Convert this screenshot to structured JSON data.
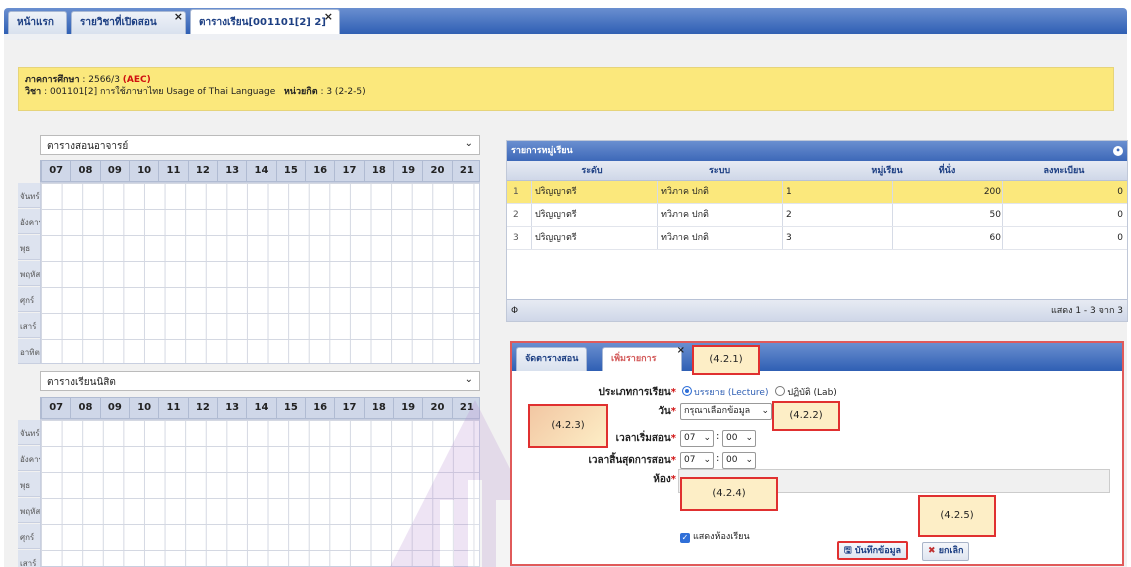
{
  "tabs": [
    {
      "label": "หน้าแรก"
    },
    {
      "label": "รายวิชาที่เปิดสอน",
      "close": "×"
    },
    {
      "label": "ตารางเรียน[001101[2] 2]",
      "close": "×"
    }
  ],
  "info": {
    "semester_label": "ภาคการศึกษา",
    "semester_value": " : 2566/3 ",
    "aec": "(AEC)",
    "course_label": "วิชา",
    "course_value": " : 001101[2] การใช้ภาษาไทย Usage of Thai Language ",
    "credit_label": "หน่วยกิต",
    "credit_value": " : 3 (2-2-5)"
  },
  "teacher_table": {
    "select_value": "ตารางสอนอาจารย์",
    "hours": [
      "07",
      "08",
      "09",
      "10",
      "11",
      "12",
      "13",
      "14",
      "15",
      "16",
      "17",
      "18",
      "19",
      "20",
      "21"
    ],
    "days": [
      "จันทร์",
      "อังคาร",
      "พุธ",
      "พฤหัส",
      "ศุกร์",
      "เสาร์",
      "อาทิตย์"
    ]
  },
  "student_table": {
    "select_value": "ตารางเรียนนิสิต",
    "hours": [
      "07",
      "08",
      "09",
      "10",
      "11",
      "12",
      "13",
      "14",
      "15",
      "16",
      "17",
      "18",
      "19",
      "20",
      "21"
    ],
    "days": [
      "จันทร์",
      "อังคาร",
      "พุธ",
      "พฤหัส",
      "ศุกร์",
      "เสาร์"
    ]
  },
  "groups": {
    "title": "รายการหมู่เรียน",
    "collapse_icon": "•",
    "columns": [
      "ระดับ",
      "ระบบ",
      "หมู่เรียน",
      "ที่นั่ง",
      "ลงทะเบียน"
    ],
    "rows": [
      {
        "n": "1",
        "level": "ปริญญาตรี",
        "system": "ทวิภาค ปกติ",
        "group": "1",
        "seats": "200",
        "registered": "0"
      },
      {
        "n": "2",
        "level": "ปริญญาตรี",
        "system": "ทวิภาค ปกติ",
        "group": "2",
        "seats": "50",
        "registered": "0"
      },
      {
        "n": "3",
        "level": "ปริญญาตรี",
        "system": "ทวิภาค ปกติ",
        "group": "3",
        "seats": "60",
        "registered": "0"
      }
    ],
    "refresh_icon": "Φ",
    "footer": "แสดง 1 - 3 จาก 3"
  },
  "form": {
    "tab_schedule": "จัดตารางสอน",
    "tab_add": "เพิ่มรายการ",
    "tab_close": "×",
    "type_label": "ประเภทการเรียน",
    "type_lecture": "บรรยาย (Lecture)",
    "type_lab": "ปฏิบัติ (Lab)",
    "day_label": "วัน",
    "day_value": "กรุณาเลือกข้อมูล",
    "start_label": "เวลาเริ่มสอน",
    "start_hour": "07",
    "start_min": "00",
    "end_label": "เวลาสิ้นสุดการสอน",
    "end_hour": "07",
    "end_min": "00",
    "room_label": "ห้อง",
    "room_value": "",
    "show_rooms": "แสดงห้องเรียน",
    "save": "บันทึกข้อมูล",
    "cancel": "ยกเลิก",
    "req": "*",
    "colon": ":",
    "chev": "⌄",
    "check": "✓",
    "save_icon": "🖫",
    "cancel_icon": "✖"
  },
  "annotations": [
    "(4.2.1)",
    "(4.2.2)",
    "(4.2.3)",
    "(4.2.4)",
    "(4.2.5)"
  ]
}
